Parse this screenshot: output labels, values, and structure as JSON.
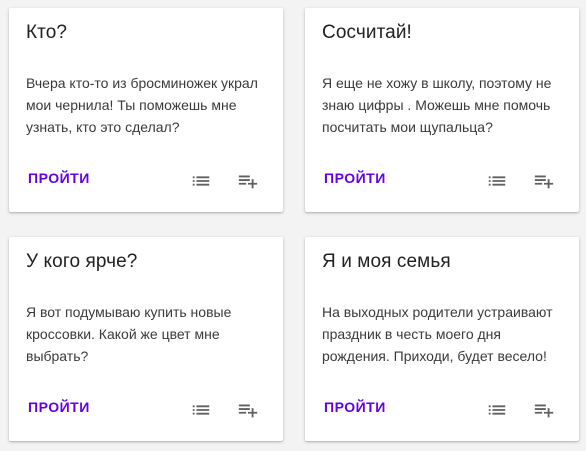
{
  "colors": {
    "accent": "#6200ea",
    "icon": "#616161",
    "title": "#212121",
    "text": "#3a3a3a",
    "background": "#f3f3f3"
  },
  "cards": [
    {
      "title": "Кто?",
      "text": "Вчера кто-то из бросминожек украл мои чернила! Ты поможешь мне узнать, кто это сделал?",
      "button_label": "ПРОЙТИ",
      "icons": [
        "list-icon",
        "playlist-add-icon"
      ]
    },
    {
      "title": "Сосчитай!",
      "text": "Я еще не хожу в школу, поэтому не знаю цифры . Можешь мне помочь посчитать мои щупальца?",
      "button_label": "ПРОЙТИ",
      "icons": [
        "list-icon",
        "playlist-add-icon"
      ]
    },
    {
      "title": "У кого ярче?",
      "text": "Я вот подумываю купить новые кроссовки. Какой же цвет мне выбрать?",
      "button_label": "ПРОЙТИ",
      "icons": [
        "list-icon",
        "playlist-add-icon"
      ]
    },
    {
      "title": "Я и моя семья",
      "text": "На выходных родители устраивают праздник в честь моего дня рождения. Приходи, будет весело!",
      "button_label": "ПРОЙТИ",
      "icons": [
        "list-icon",
        "playlist-add-icon"
      ]
    }
  ]
}
